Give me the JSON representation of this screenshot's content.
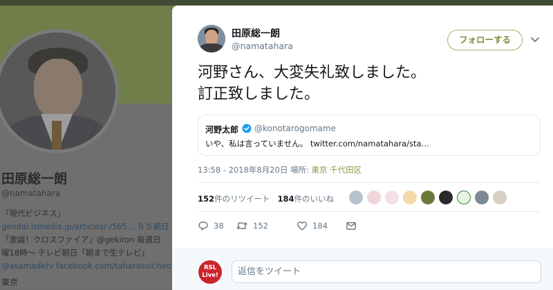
{
  "background_profile": {
    "name": "田原総一朗",
    "handle": "@namatahara",
    "bio_lines": [
      "「現代ビジネス」",
      "gendai.ismedia.jp/articles/-/565... ＢＳ朝日",
      "「激論！クロスファイア」@gekiron 毎週日",
      "曜18時〜 テレビ朝日「朝まで生テレビ」",
      "@asamadetv facebook.com/taharasoichiro"
    ],
    "location": "東京"
  },
  "tweet": {
    "author_name": "田原総一朗",
    "author_handle": "@namatahara",
    "follow_label": "フォローする",
    "text_line1": "河野さん、大変失礼致しました。",
    "text_line2": "訂正致しました。",
    "quoted": {
      "name": "河野太郎",
      "handle": "@konotarogomame",
      "text": "いや、私は言っていません。 twitter.com/namatahara/sta…"
    },
    "meta_time": "13:58 - 2018年8月20日 場所: ",
    "meta_location": "東京 千代田区",
    "retweets_count": "152",
    "retweets_label": "件のリツイート",
    "likes_count": "184",
    "likes_label": "件のいいね",
    "actions": {
      "reply_count": "38",
      "retweet_count": "152",
      "like_count": "184"
    },
    "reply_placeholder": "返信をツイート",
    "reply_avatar_text": "RSL Live!"
  },
  "colors": {
    "accent": "#7f8d3e",
    "location_link": "#8a9a4a",
    "verified": "#1da1f2",
    "muted_text": "#657786"
  }
}
